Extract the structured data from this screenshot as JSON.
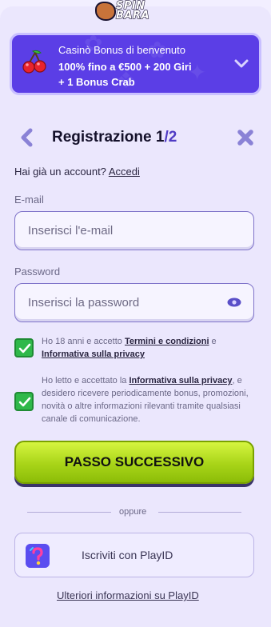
{
  "logo": {
    "text_line1": "SPIN",
    "text_line2": "BARA"
  },
  "bonus": {
    "title": "Casinò Bonus di benvenuto",
    "line1": "100% fino a €500 + 200 Giri",
    "line2": "+ 1 Bonus Crab",
    "icon": "cherries-icon",
    "expand_icon": "chevron-down-icon"
  },
  "header": {
    "title_main": "Registrazione 1",
    "title_sep": "/",
    "title_total": "2",
    "back_icon": "chevron-left-icon",
    "close_icon": "close-icon"
  },
  "login": {
    "prompt": "Hai già un account?",
    "link": "Accedi"
  },
  "form": {
    "email_label": "E-mail",
    "email_placeholder": "Inserisci l'e-mail",
    "password_label": "Password",
    "password_placeholder": "Inserisci la password"
  },
  "consents": {
    "c1_before": "Ho 18 anni e accetto ",
    "c1_link1": "Termini e condizioni",
    "c1_mid": " e ",
    "c1_link2": "Informativa sulla privacy",
    "c1_checked": true,
    "c2_before": "Ho letto e accettato la ",
    "c2_link": "Informativa sulla privacy",
    "c2_after": ", e desidero ricevere periodicamente bonus, promozioni, novità o altre informazioni rilevanti tramite qualsiasi canale di comunicazione.",
    "c2_checked": true
  },
  "actions": {
    "next_label": "PASSO SUCCESSIVO",
    "divider": "oppure",
    "playid_label": "Iscriviti con PlayID",
    "more_info": "Ulteriori informazioni su PlayID"
  },
  "colors": {
    "accent": "#5b3ee6",
    "primary_button": "#b5de1c",
    "checkbox": "#2fb84a",
    "background": "#ebe7fd"
  }
}
